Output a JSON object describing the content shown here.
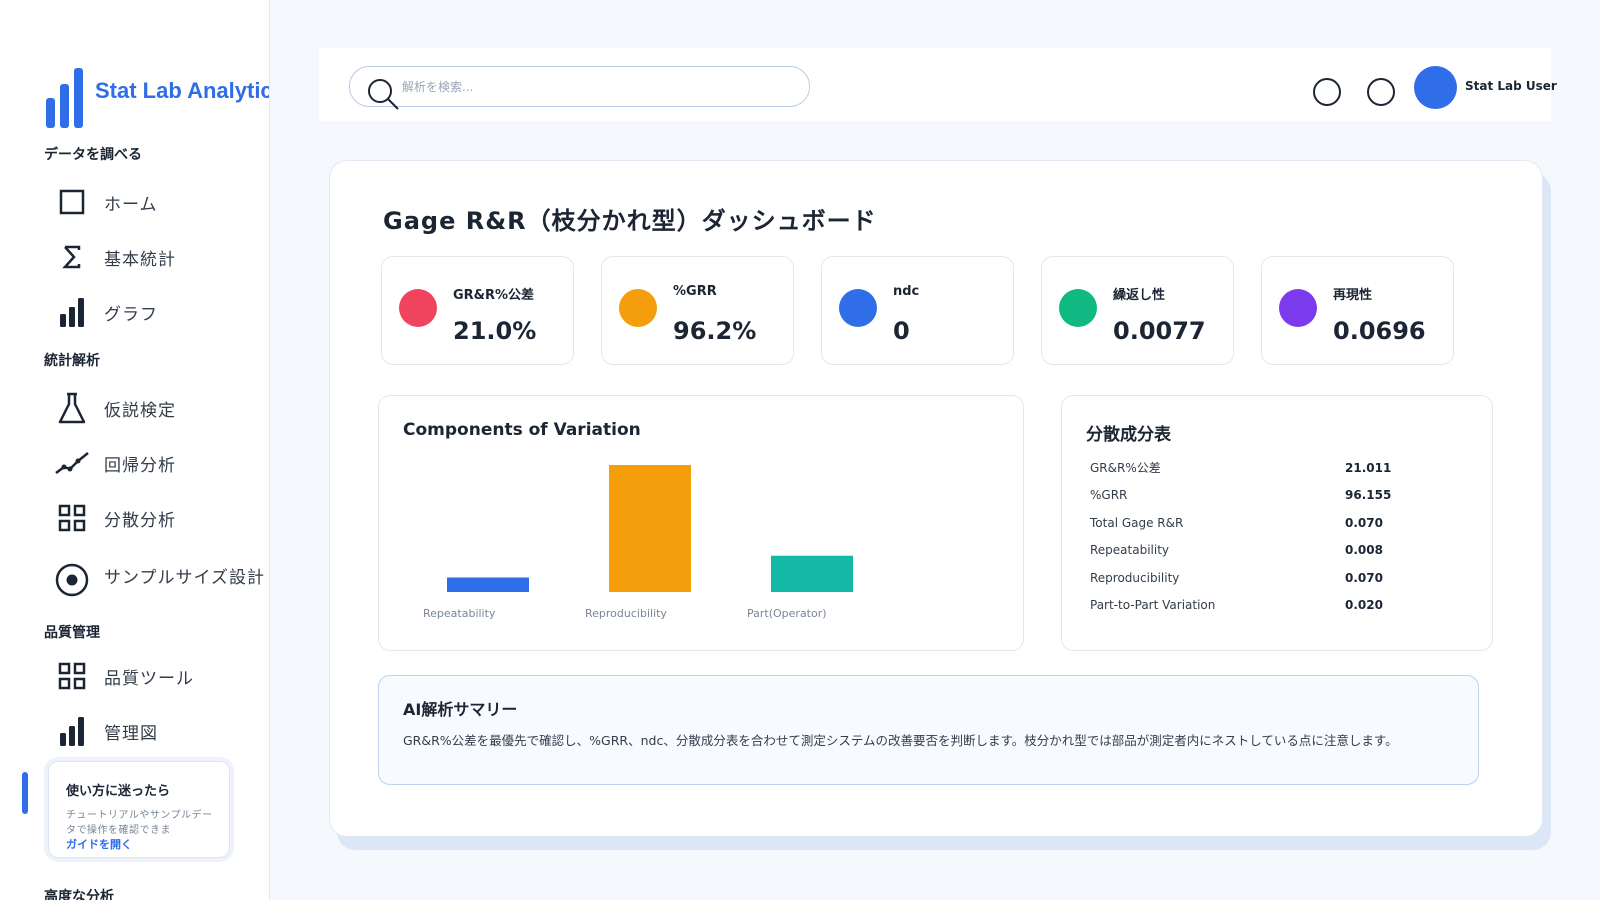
{
  "app": {
    "title": "Stat Lab Analytics",
    "accent_color": "#2f6ee8"
  },
  "sidebar": {
    "sections": [
      {
        "label": "データを調べる",
        "items": [
          {
            "label": "ホーム",
            "icon": "home-square-icon"
          },
          {
            "label": "基本統計",
            "icon": "sigma-icon"
          },
          {
            "label": "グラフ",
            "icon": "bar-chart-icon"
          }
        ]
      },
      {
        "label": "統計解析",
        "items": [
          {
            "label": "仮説検定",
            "icon": "flask-icon"
          },
          {
            "label": "回帰分析",
            "icon": "trend-line-icon"
          },
          {
            "label": "分散分析",
            "icon": "grid-icon"
          },
          {
            "label": "サンプルサイズ設計",
            "icon": "target-icon"
          }
        ]
      },
      {
        "label": "品質管理",
        "items": [
          {
            "label": "品質ツール",
            "icon": "grid-icon"
          },
          {
            "label": "管理図",
            "icon": "bar-chart-icon"
          }
        ]
      },
      {
        "label": "高度な分析",
        "items": []
      }
    ],
    "help": {
      "title": "使い方に迷ったら",
      "text": "チュートリアルやサンプルデータで操作を確認できま",
      "link": "ガイドを開く"
    }
  },
  "topbar": {
    "search_placeholder": "解析を検索...",
    "user_name": "Stat Lab User"
  },
  "dashboard": {
    "title": "Gage R&R（枝分かれ型）ダッシュボード",
    "kpis": [
      {
        "label": "GR&R%公差",
        "value": "21.0%",
        "color": "#f0445e"
      },
      {
        "label": "%GRR",
        "value": "96.2%",
        "color": "#f59e0b"
      },
      {
        "label": "ndc",
        "value": "0",
        "color": "#2f6ee8"
      },
      {
        "label": "繰返し性",
        "value": "0.0077",
        "color": "#10b981"
      },
      {
        "label": "再現性",
        "value": "0.0696",
        "color": "#7c3aed"
      }
    ],
    "variance_table": {
      "title": "分散成分表",
      "rows": [
        {
          "key": "GR&R%公差",
          "value": "21.011"
        },
        {
          "key": "%GRR",
          "value": "96.155"
        },
        {
          "key": "Total Gage R&R",
          "value": "0.070"
        },
        {
          "key": "Repeatability",
          "value": "0.008"
        },
        {
          "key": "Reproducibility",
          "value": "0.070"
        },
        {
          "key": "Part-to-Part Variation",
          "value": "0.020"
        }
      ]
    },
    "summary": {
      "title": "AI解析サマリー",
      "text": "GR&R%公差を最優先で確認し、%GRR、ndc、分散成分表を合わせて測定システムの改善要否を判断します。枝分かれ型では部品が測定者内にネストしている点に注意します。"
    }
  },
  "chart_data": {
    "type": "bar",
    "title": "Components of Variation",
    "categories": [
      "Repeatability",
      "Reproducibility",
      "Part(Operator)"
    ],
    "values": [
      0.008,
      0.07,
      0.02
    ],
    "colors": [
      "#2f6ee8",
      "#f59e0b",
      "#14b8a6"
    ],
    "ylim": [
      0,
      0.07
    ],
    "grid": false,
    "xlabel": "",
    "ylabel": ""
  }
}
